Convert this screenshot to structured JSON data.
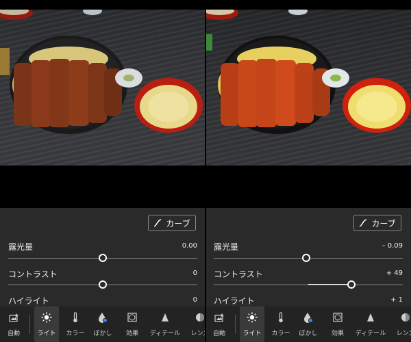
{
  "curve_button": {
    "label": "カーブ"
  },
  "left": {
    "sliders": [
      {
        "label": "露光量",
        "value": "0.00",
        "position": 0.5
      },
      {
        "label": "コントラスト",
        "value": "0",
        "position": 0.5
      },
      {
        "label": "ハイライト",
        "value": "0"
      }
    ]
  },
  "right": {
    "sliders": [
      {
        "label": "露光量",
        "value": "– 0.09",
        "position": 0.49
      },
      {
        "label": "コントラスト",
        "value": "+ 49",
        "position": 0.73
      },
      {
        "label": "ハイライト",
        "value": "+ 1"
      }
    ]
  },
  "nav": {
    "items": [
      {
        "label": "自動",
        "icon": "auto-photo-icon"
      },
      {
        "label": "ライト",
        "icon": "sun-icon",
        "active": true
      },
      {
        "label": "カラー",
        "icon": "thermometer-icon"
      },
      {
        "label": "ぼかし",
        "icon": "drop-icon"
      },
      {
        "label": "効果",
        "icon": "effects-frame-icon"
      },
      {
        "label": "ディテール",
        "icon": "triangle-icon"
      },
      {
        "label": "レンズ",
        "icon": "lens-icon"
      }
    ]
  },
  "colors": {
    "panel_bg": "#2a2a2a",
    "bar_bg": "#232323",
    "accent": "#ffffff"
  }
}
